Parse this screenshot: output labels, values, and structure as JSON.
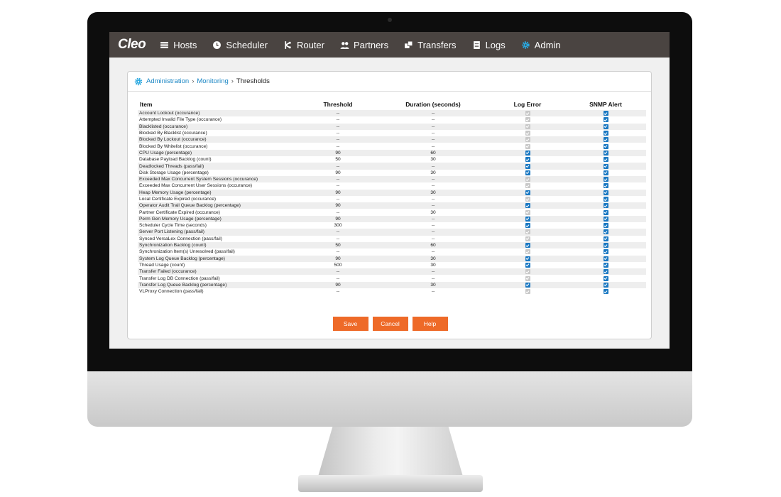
{
  "nav": {
    "logo": "Cleo",
    "items": [
      {
        "label": "Hosts",
        "icon": "hosts-icon"
      },
      {
        "label": "Scheduler",
        "icon": "clock-icon"
      },
      {
        "label": "Router",
        "icon": "router-icon"
      },
      {
        "label": "Partners",
        "icon": "partners-icon"
      },
      {
        "label": "Transfers",
        "icon": "transfers-icon"
      },
      {
        "label": "Logs",
        "icon": "logs-icon"
      },
      {
        "label": "Admin",
        "icon": "gear-icon"
      }
    ],
    "admin_icon_color": "#29a8e0"
  },
  "breadcrumb": {
    "items": [
      "Administration",
      "Monitoring",
      "Thresholds"
    ],
    "icon": "gear-icon"
  },
  "table": {
    "headers": [
      "Item",
      "Threshold",
      "Duration (seconds)",
      "Log Error",
      "SNMP Alert"
    ],
    "rows": [
      {
        "item": "Account Lockout (occurance)",
        "threshold": "--",
        "duration": "--",
        "log_error": false,
        "snmp": true
      },
      {
        "item": "Attempted Invalid File Type (occurance)",
        "threshold": "--",
        "duration": "--",
        "log_error": false,
        "snmp": true
      },
      {
        "item": "Blacklisted (occurance)",
        "threshold": "--",
        "duration": "--",
        "log_error": false,
        "snmp": true
      },
      {
        "item": "Blocked By Blacklist (occurance)",
        "threshold": "--",
        "duration": "--",
        "log_error": false,
        "snmp": true
      },
      {
        "item": "Blocked By Lockout (occurance)",
        "threshold": "--",
        "duration": "--",
        "log_error": false,
        "snmp": true
      },
      {
        "item": "Blocked By Whitelist (occurance)",
        "threshold": "--",
        "duration": "--",
        "log_error": false,
        "snmp": true
      },
      {
        "item": "CPU Usage (percentage)",
        "threshold": "90",
        "duration": "60",
        "log_error": true,
        "snmp": true
      },
      {
        "item": "Database Payload Backlog (count)",
        "threshold": "50",
        "duration": "30",
        "log_error": true,
        "snmp": true
      },
      {
        "item": "Deadlocked Threads (pass/fail)",
        "threshold": "--",
        "duration": "--",
        "log_error": true,
        "snmp": true
      },
      {
        "item": "Disk Storage Usage (percentage)",
        "threshold": "90",
        "duration": "30",
        "log_error": true,
        "snmp": true
      },
      {
        "item": "Exceeded Max Concurrent System Sessions (occurance)",
        "threshold": "--",
        "duration": "--",
        "log_error": false,
        "snmp": true
      },
      {
        "item": "Exceeded Max Concurrent User Sessions (occurance)",
        "threshold": "--",
        "duration": "--",
        "log_error": false,
        "snmp": true
      },
      {
        "item": "Heap Memory Usage (percentage)",
        "threshold": "90",
        "duration": "30",
        "log_error": true,
        "snmp": true
      },
      {
        "item": "Local Certificate Expired (occurance)",
        "threshold": "--",
        "duration": "--",
        "log_error": false,
        "snmp": true
      },
      {
        "item": "Operator Audit Trail Queue Backlog (percentage)",
        "threshold": "90",
        "duration": "--",
        "log_error": true,
        "snmp": true
      },
      {
        "item": "Partner Certificate Expired (occurance)",
        "threshold": "--",
        "duration": "30",
        "log_error": false,
        "snmp": true
      },
      {
        "item": "Perm Gen Memory Usage (percentage)",
        "threshold": "90",
        "duration": "--",
        "log_error": true,
        "snmp": true
      },
      {
        "item": "Scheduler Cycle Time (seconds)",
        "threshold": "300",
        "duration": "--",
        "log_error": true,
        "snmp": true
      },
      {
        "item": "Server Port Listening (pass/fail)",
        "threshold": "--",
        "duration": "--",
        "log_error": false,
        "snmp": true
      },
      {
        "item": "Synced VersaLex Connection (pass/fail)",
        "threshold": "--",
        "duration": "--",
        "log_error": false,
        "snmp": true
      },
      {
        "item": "Synchronization Backlog (count)",
        "threshold": "50",
        "duration": "60",
        "log_error": true,
        "snmp": true
      },
      {
        "item": "Synchronization Item(s) Unresolved (pass/fail)",
        "threshold": "--",
        "duration": "--",
        "log_error": false,
        "snmp": true
      },
      {
        "item": "System Log Queue Backlog (percentage)",
        "threshold": "90",
        "duration": "30",
        "log_error": true,
        "snmp": true
      },
      {
        "item": "Thread Usage (count)",
        "threshold": "500",
        "duration": "30",
        "log_error": true,
        "snmp": true
      },
      {
        "item": "Transfer Failed (occurance)",
        "threshold": "--",
        "duration": "--",
        "log_error": false,
        "snmp": true
      },
      {
        "item": "Transfer Log DB Connection (pass/fail)",
        "threshold": "--",
        "duration": "--",
        "log_error": false,
        "snmp": true
      },
      {
        "item": "Transfer Log Queue Backlog (percentage)",
        "threshold": "90",
        "duration": "30",
        "log_error": true,
        "snmp": true
      },
      {
        "item": "VLProxy Connection (pass/fail)",
        "threshold": "--",
        "duration": "--",
        "log_error": false,
        "snmp": true
      }
    ]
  },
  "buttons": {
    "save": "Save",
    "cancel": "Cancel",
    "help": "Help"
  },
  "colors": {
    "navbar": "#4a4441",
    "link": "#1a86c4",
    "button": "#ee6a28",
    "checkbox_on": "#1a78c2",
    "checkbox_off": "#c8c8c8"
  }
}
